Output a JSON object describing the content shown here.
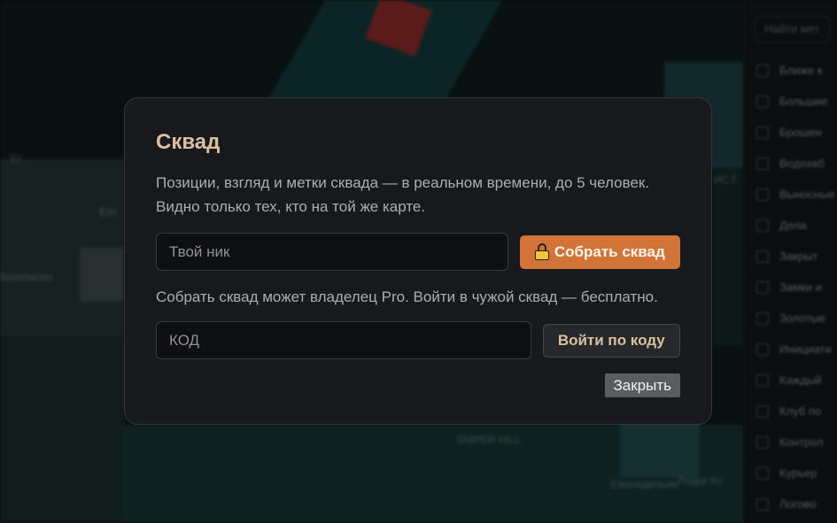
{
  "background": {
    "map_labels": [
      "ЗУ",
      "Еxc",
      "Безопасно",
      "SNIPER HILL",
      "Еженедельно",
      "Лодка Ко",
      "ИС Г",
      "ЗУ"
    ],
    "panel": {
      "search_placeholder": "Найти мет",
      "items": [
        "Ближе к",
        "Большие",
        "Брошен",
        "Водозаб",
        "Выносные",
        "Дела",
        "Закрыт",
        "Замки и",
        "Золотые",
        "Инициати",
        "Каждый",
        "Клуб по",
        "Контрол",
        "Курьер",
        "Логово"
      ]
    }
  },
  "modal": {
    "title": "Сквад",
    "description_line1": "Позиции, взгляд и метки сквада — в реальном времени, до 5 человек.",
    "description_line2": "Видно только тех, кто на той же карте.",
    "nickname_placeholder": "Твой ник",
    "create_button": "Собрать сквад",
    "note": "Собрать сквад может владелец Pro. Войти в чужой сквад — бесплатно.",
    "code_placeholder": "КОД",
    "join_button": "Войти по коду",
    "close_button": "Закрыть"
  },
  "colors": {
    "accent": "#d2733a",
    "title": "#d9c0a0",
    "modal_bg": "#17191c"
  }
}
